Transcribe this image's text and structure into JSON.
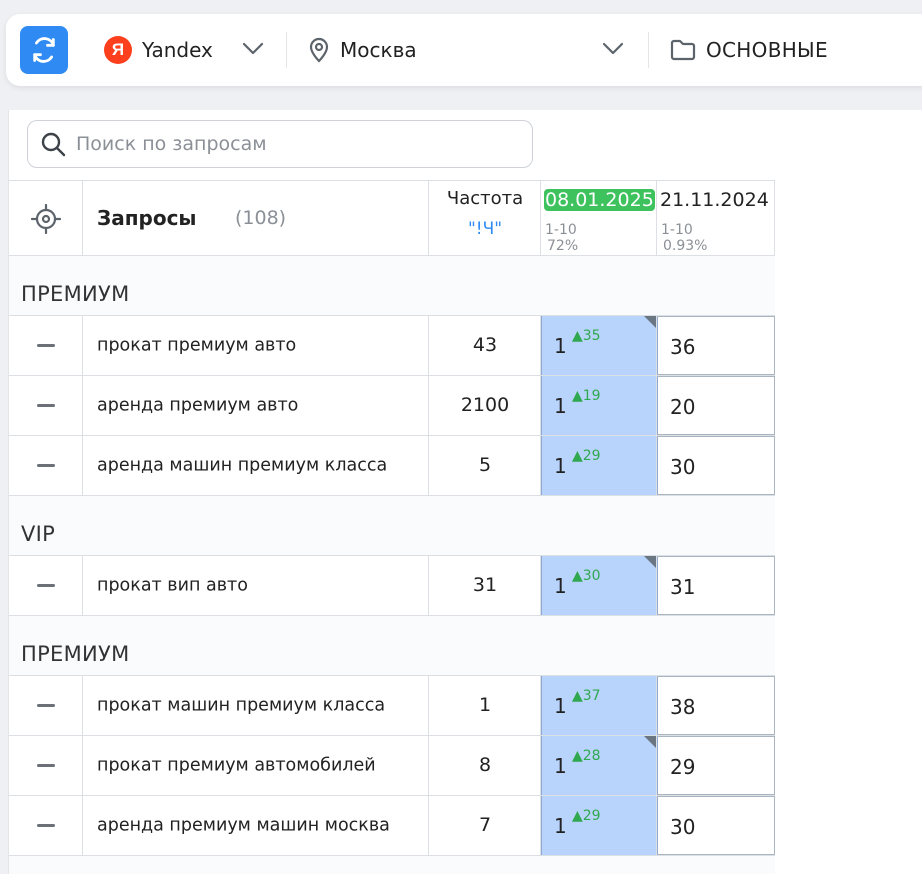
{
  "toolbar": {
    "engine": "Yandex",
    "engine_logo_letter": "Я",
    "region": "Москва",
    "folder": "ОСНОВНЫЕ",
    "accent_color": "#2f8bf3"
  },
  "search": {
    "placeholder": "Поиск по запросам",
    "value": ""
  },
  "table": {
    "header": {
      "queries_label": "Запросы",
      "queries_count": "(108)",
      "freq_label": "Частота",
      "freq_mode": "\"!Ч\"",
      "dates": [
        {
          "date": "08.01.2025",
          "range": "1-10",
          "pct": "72%",
          "active": true
        },
        {
          "date": "21.11.2024",
          "range": "1-10",
          "pct": "0.93%",
          "active": false
        }
      ]
    },
    "groups": [
      {
        "label": "ПРЕМИУМ",
        "rows": [
          {
            "query": "прокат премиум авто",
            "freq": "43",
            "pos": "1",
            "delta": "▲35",
            "prev": "36",
            "flag": true
          },
          {
            "query": "аренда премиум авто",
            "freq": "2100",
            "pos": "1",
            "delta": "▲19",
            "prev": "20",
            "flag": false
          },
          {
            "query": "аренда машин премиум класса",
            "freq": "5",
            "pos": "1",
            "delta": "▲29",
            "prev": "30",
            "flag": false
          }
        ]
      },
      {
        "label": "VIP",
        "rows": [
          {
            "query": "прокат вип авто",
            "freq": "31",
            "pos": "1",
            "delta": "▲30",
            "prev": "31",
            "flag": true
          }
        ]
      },
      {
        "label": "ПРЕМИУМ",
        "rows": [
          {
            "query": "прокат машин премиум класса",
            "freq": "1",
            "pos": "1",
            "delta": "▲37",
            "prev": "38",
            "flag": false
          },
          {
            "query": "прокат премиум автомобилей",
            "freq": "8",
            "pos": "1",
            "delta": "▲28",
            "prev": "29",
            "flag": true
          },
          {
            "query": "аренда премиум машин москва",
            "freq": "7",
            "pos": "1",
            "delta": "▲29",
            "prev": "30",
            "flag": false
          }
        ]
      }
    ]
  }
}
